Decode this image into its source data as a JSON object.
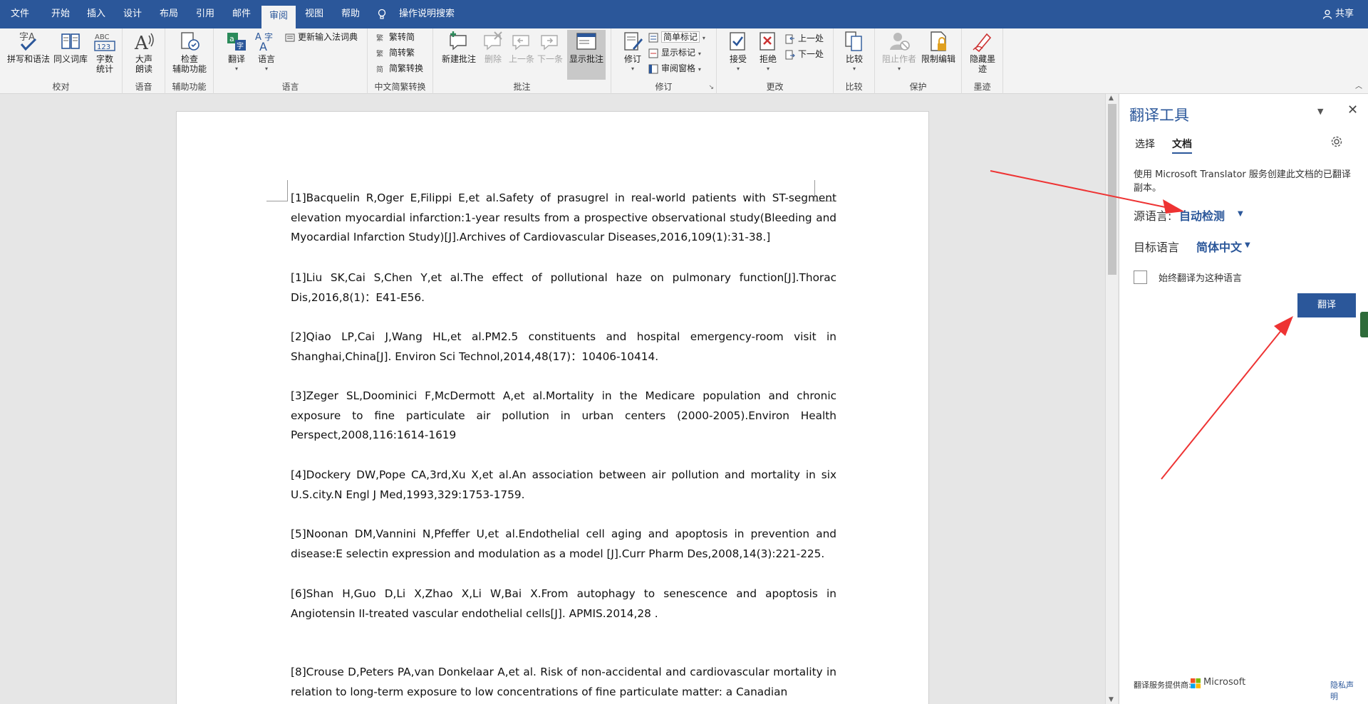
{
  "menu": {
    "tabs": [
      "文件",
      "开始",
      "插入",
      "设计",
      "布局",
      "引用",
      "邮件",
      "审阅",
      "视图",
      "帮助"
    ],
    "active_tab": "审阅",
    "search_label": "操作说明搜索",
    "share_label": "共享"
  },
  "ribbon": {
    "groups": {
      "proofing": {
        "label": "校对",
        "spelling": "拼写和语法",
        "thesaurus": "同义词库",
        "wordcount_line1": "字数",
        "wordcount_line2": "统计"
      },
      "speech": {
        "label": "语音",
        "read_aloud_line1": "大声",
        "read_aloud_line2": "朗读"
      },
      "accessibility": {
        "label": "辅助功能",
        "check_line1": "检查",
        "check_line2": "辅助功能"
      },
      "language": {
        "label": "语言",
        "translate": "翻译",
        "language": "语言",
        "update_ime": "更新输入法词典"
      },
      "chinese_conversion": {
        "label": "中文简繁转换",
        "to_simplified": "繁转简",
        "to_traditional": "简转繁",
        "convert": "简繁转换"
      },
      "comments": {
        "label": "批注",
        "new": "新建批注",
        "delete": "删除",
        "previous": "上一条",
        "next": "下一条",
        "show": "显示批注"
      },
      "tracking": {
        "label": "修订",
        "track_changes": "修订",
        "simple_markup": "简单标记",
        "show_markup": "显示标记",
        "review_pane": "审阅窗格"
      },
      "changes": {
        "label": "更改",
        "accept": "接受",
        "reject": "拒绝",
        "previous": "上一处",
        "next": "下一处"
      },
      "compare": {
        "label": "比较",
        "compare": "比较"
      },
      "protect": {
        "label": "保护",
        "block_authors": "阻止作者",
        "restrict_editing": "限制编辑"
      },
      "ink": {
        "label": "墨迹",
        "hide_ink_line1": "隐藏墨",
        "hide_ink_line2": "迹"
      }
    }
  },
  "document": {
    "paragraphs": [
      "[1]Bacquelin R,Oger E,Filippi E,et al.Safety of prasugrel in real-world patients with ST-segment elevation myocardial infarction:1-year results from a prospective observational study(Bleeding and Myocardial Infarction Study)[J].Archives of Cardiovascular Diseases,2016,109(1):31-38.]",
      "[1]Liu SK,Cai S,Chen Y,et al.The effect of pollutional haze on pulmonary function[J].Thorac Dis,2016,8(1)：E41-E56.",
      "[2]Qiao LP,Cai J,Wang HL,et al.PM2.5 constituents and hospital emergency-room visit in Shanghai,China[J]. Environ Sci Technol,2014,48(17)：10406-10414.",
      "[3]Zeger SL,Doominici F,McDermott A,et al.Mortality in the Medicare population and chronic exposure to fine particulate air pollution in urban centers (2000-2005).Environ Health Perspect,2008,116:1614-1619",
      "[4]Dockery DW,Pope CA,3rd,Xu X,et al.An association between air pollution and mortality in six U.S.city.N Engl J Med,1993,329:1753-1759.",
      "[5]Noonan DM,Vannini N,Pfeffer U,et al.Endothelial cell aging and apoptosis in prevention and disease:E selectin expression and modulation as a model [J].Curr Pharm Des,2008,14(3):221-225.",
      "[6]Shan H,Guo D,Li X,Zhao X,Li W,Bai X.From autophagy to senescence and apoptosis in Angiotensin II-treated vascular endothelial cells[J]. APMIS.2014,28 .",
      "[8]Crouse D,Peters PA,van Donkelaar A,et al. Risk of non-accidental and cardiovascular mortality in relation to long-term exposure to low concentrations of fine particulate matter: a Canadian"
    ]
  },
  "translator": {
    "title": "翻译工具",
    "tab_selection": "选择",
    "tab_document": "文档",
    "active_tab": "文档",
    "description": "使用 Microsoft Translator 服务创建此文档的已翻译副本。",
    "source_label": "源语言:",
    "source_value": "自动检测",
    "target_label": "目标语言",
    "target_value": "简体中文",
    "always_translate_label": "始终翻译为这种语言",
    "always_translate_checked": false,
    "translate_button": "翻译",
    "footer_provider": "翻译服务提供商:",
    "footer_brand": "Microsoft",
    "footer_privacy": "隐私声明"
  },
  "colors": {
    "accent": "#2b579a",
    "annotation_arrow": "#ee3333"
  }
}
